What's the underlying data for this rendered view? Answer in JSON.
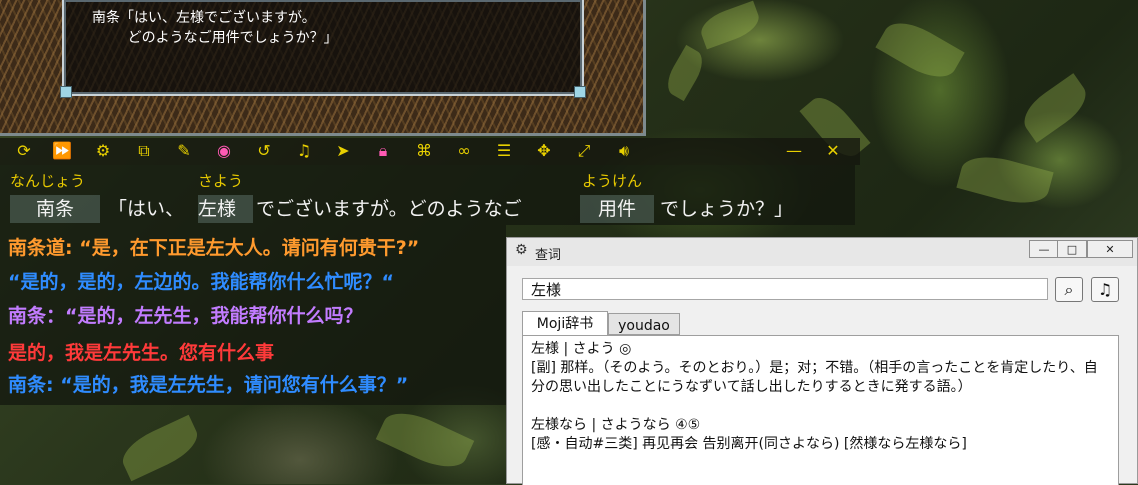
{
  "game": {
    "dialogue_line1": "南条「はい、左様でございますが。",
    "dialogue_line2": "        どのようなご用件でしょうか？」"
  },
  "toolbar": {
    "icons": [
      "reload-icon",
      "forward-icon",
      "gear-icon",
      "copy-icon",
      "edit-icon",
      "eye-icon",
      "undo-icon",
      "music-icon",
      "cursor-icon",
      "lock-icon",
      "gamepad-icon",
      "link-icon",
      "list-icon",
      "move-icon",
      "resize-icon",
      "volume-icon",
      "minimize-icon",
      "close-icon"
    ]
  },
  "reader": {
    "furigana": {
      "nanjou": "なんじょう",
      "sayou": "さよう",
      "youken": "ようけん"
    },
    "words": {
      "w1": "南条",
      "w2": "「はい、",
      "w3": "左様",
      "w4": "でございますが。どのようなご",
      "w5": "用件",
      "w6": "でしょうか？」"
    }
  },
  "translations": [
    {
      "text": "南条道: “是，在下正是左大人。请问有何贵干?”",
      "color": "#ff9a2e"
    },
    {
      "text": "“是的，是的，左边的。我能帮你什么忙呢？“",
      "color": "#2f8cff"
    },
    {
      "text": "南条：“是的，左先生，我能帮你什么吗？",
      "color": "#c27cff"
    },
    {
      "text": "是的，我是左先生。您有什么事",
      "color": "#ff3a3a"
    },
    {
      "text": "南条: “是的，我是左先生，请问您有什么事？”",
      "color": "#2f8cff"
    }
  ],
  "dict": {
    "title": "查词",
    "buttons": {
      "minimize": "—",
      "maximize": "□",
      "close": "✕"
    },
    "search_value": "左様",
    "search_icon": "magnifier-icon",
    "audio_icon": "music-note-icon",
    "tabs": [
      "Moji辞书",
      "youdao"
    ],
    "entry1_head": "左様 | さよう ◎",
    "entry1_body": "[副] 那样。（そのよう。そのとおり。）是；对；不错。（相手の言ったことを肯定したり、自分の思い出したことにうなずいて話し出したりするときに発する語。）",
    "entry2_head": "左様なら | さようなら ④⑤",
    "entry2_body": "[感・自动#三类] 再见再会 告别离开(同さよなら) [然様なら左様なら]"
  }
}
